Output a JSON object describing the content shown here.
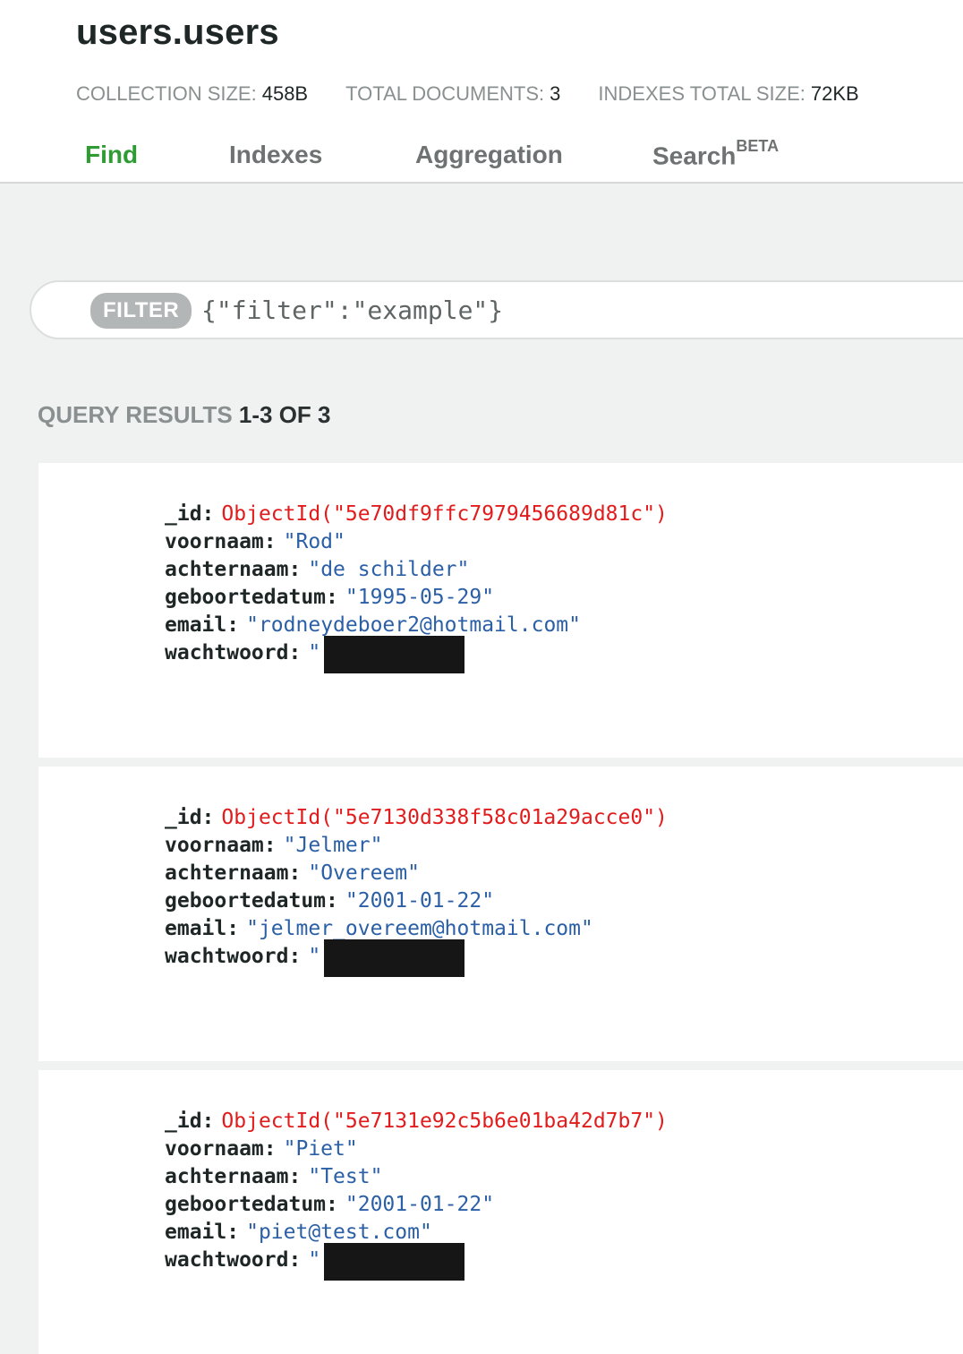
{
  "header": {
    "title": "users.users",
    "stats": [
      {
        "label": "COLLECTION SIZE:",
        "value": "458B"
      },
      {
        "label": "TOTAL DOCUMENTS:",
        "value": "3"
      },
      {
        "label": "INDEXES TOTAL SIZE:",
        "value": "72KB"
      }
    ],
    "tabs": [
      {
        "label": "Find",
        "active": true
      },
      {
        "label": "Indexes",
        "active": false
      },
      {
        "label": "Aggregation",
        "active": false
      },
      {
        "label": "Search",
        "sup": "BETA",
        "active": false
      }
    ]
  },
  "filter": {
    "badge": "FILTER",
    "placeholder": "{\"filter\":\"example\"}"
  },
  "results": {
    "label": "QUERY RESULTS",
    "count": "1-3 OF 3"
  },
  "documents": [
    {
      "id_key": "_id",
      "id_value": "ObjectId(\"5e70df9ffc7979456689d81c\")",
      "voornaam": "\"Rod\"",
      "achternaam": "\"de schilder\"",
      "geboortedatum": "\"1995-05-29\"",
      "email": "\"rodneydeboer2@hotmail.com\"",
      "wachtwoord_prefix": "\""
    },
    {
      "id_key": "_id",
      "id_value": "ObjectId(\"5e7130d338f58c01a29acce0\")",
      "voornaam": "\"Jelmer\"",
      "achternaam": "\"Overeem\"",
      "geboortedatum": "\"2001-01-22\"",
      "email": "\"jelmer_overeem@hotmail.com\"",
      "wachtwoord_prefix": "\""
    },
    {
      "id_key": "_id",
      "id_value": "ObjectId(\"5e7131e92c5b6e01ba42d7b7\")",
      "voornaam": "\"Piet\"",
      "achternaam": "\"Test\"",
      "geboortedatum": "\"2001-01-22\"",
      "email": "\"piet@test.com\"",
      "wachtwoord_prefix": "\""
    }
  ],
  "field_keys": {
    "voornaam": "voornaam",
    "achternaam": "achternaam",
    "geboortedatum": "geboortedatum",
    "email": "email",
    "wachtwoord": "wachtwoord"
  },
  "colors": {
    "active_tab": "#2e9b33",
    "object_id": "#e21c1c",
    "string_value": "#2b5fa6",
    "redaction": "#161616"
  }
}
